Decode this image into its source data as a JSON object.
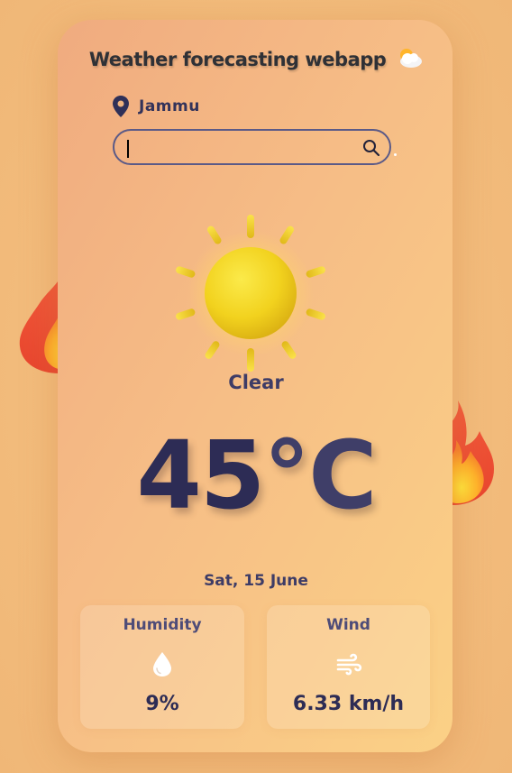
{
  "app": {
    "title": "Weather forecasting webapp",
    "title_icon": "cloud-sun-icon"
  },
  "location": {
    "icon": "map-pin-icon",
    "name": "Jammu"
  },
  "search": {
    "value": "",
    "placeholder": "",
    "icon": "search-icon"
  },
  "weather": {
    "icon": "sun-icon",
    "condition": "Clear",
    "temperature": "45",
    "unit": "°C",
    "date": "Sat, 15 June"
  },
  "stats": {
    "humidity": {
      "label": "Humidity",
      "icon": "water-drop-icon",
      "value": "9%"
    },
    "wind": {
      "label": "Wind",
      "icon": "wind-icon",
      "value": "6.33 km/h"
    }
  },
  "decorations": [
    "fire-icon",
    "fire-icon"
  ],
  "colors": {
    "background": "#f2bd7d",
    "card_start": "#f0ab7f",
    "card_end": "#fbd186",
    "text_dark": "#2d2c55",
    "text_muted": "#4e4c78",
    "sun": "#f2d21e"
  }
}
